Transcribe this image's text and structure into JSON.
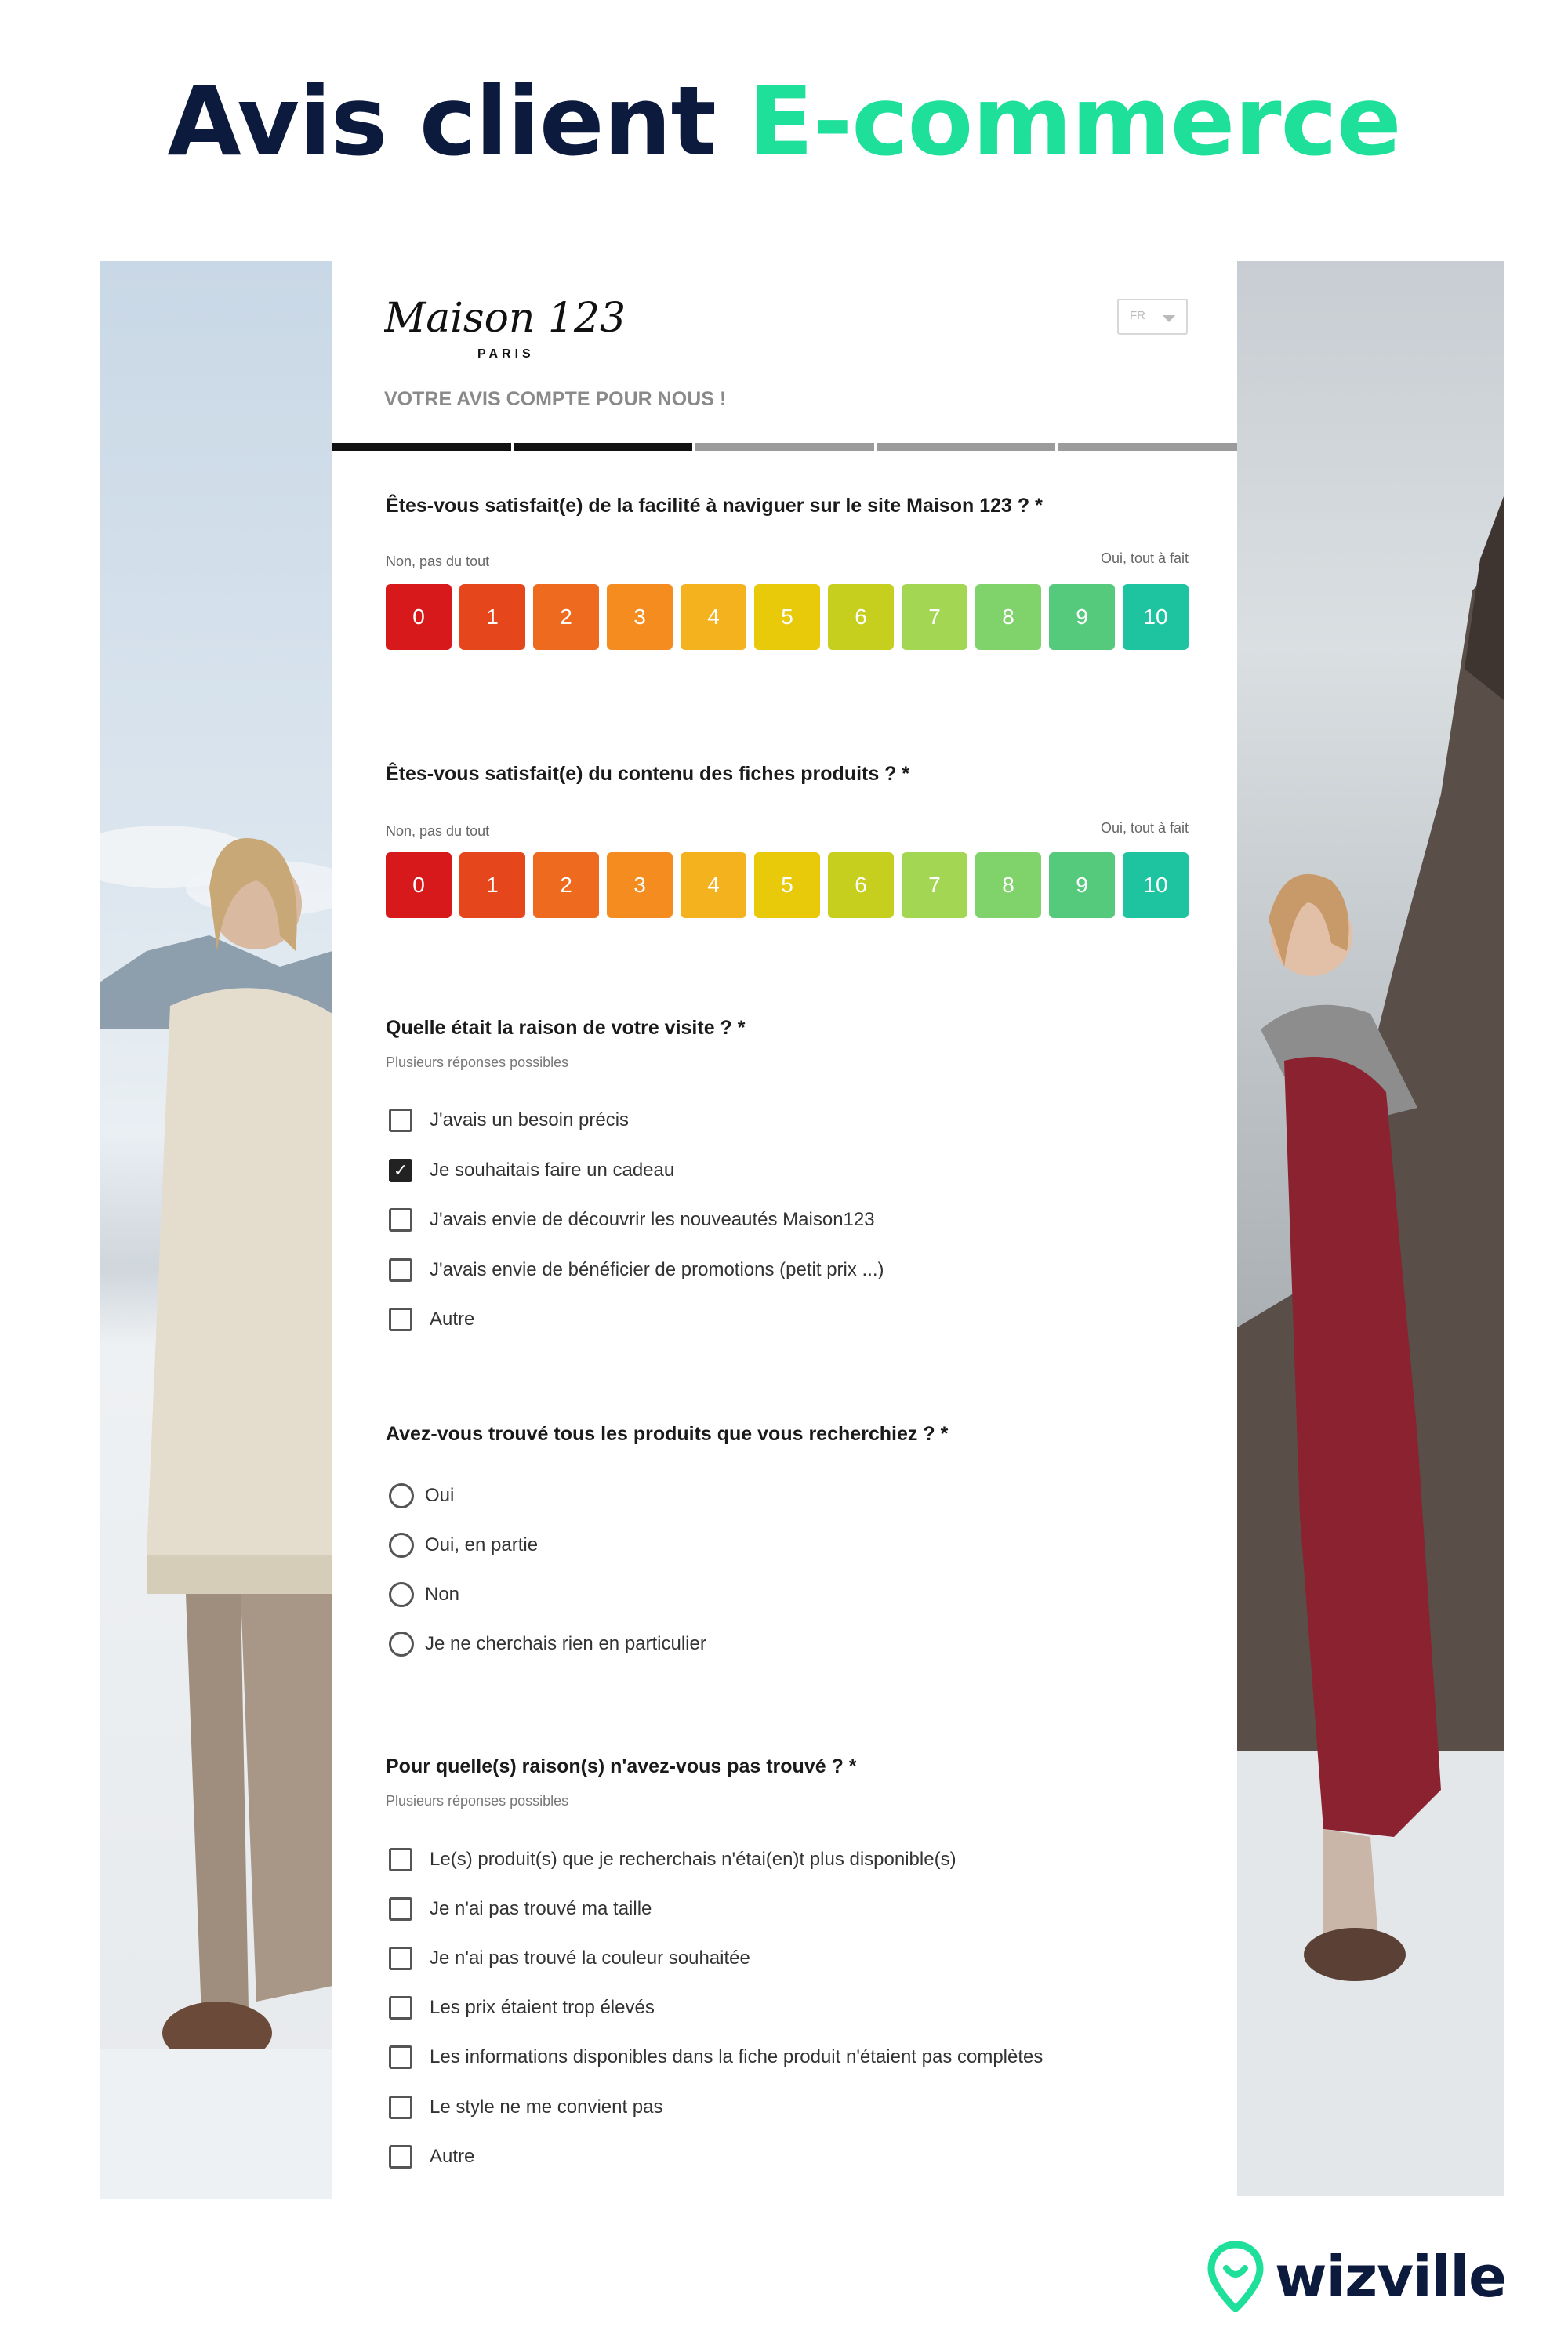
{
  "headline": {
    "part1": "Avis client",
    "part2": "E-commerce",
    "color1": "#0b1a3d",
    "color2": "#1ee09a"
  },
  "survey": {
    "logo_script": "Maison 123",
    "logo_sub": "PARIS",
    "language": "FR",
    "tagline": "VOTRE AVIS COMPTE POUR NOUS !",
    "progress": {
      "completed_steps": 2,
      "total_steps": 5
    },
    "q1": {
      "title": "Êtes-vous satisfait(e) de la facilité à naviguer sur le site Maison 123 ? *",
      "low_label": "Non, pas du tout",
      "high_label": "Oui, tout à fait",
      "scale": [
        "0",
        "1",
        "2",
        "3",
        "4",
        "5",
        "6",
        "7",
        "8",
        "9",
        "10"
      ]
    },
    "q2": {
      "title": "Êtes-vous satisfait(e) du contenu des fiches produits ? *",
      "low_label": "Non, pas du tout",
      "high_label": "Oui, tout à fait",
      "scale": [
        "0",
        "1",
        "2",
        "3",
        "4",
        "5",
        "6",
        "7",
        "8",
        "9",
        "10"
      ]
    },
    "scale_colors": [
      "#d7191c",
      "#e6461c",
      "#ed6a1f",
      "#f58c1f",
      "#f5b21f",
      "#e8ca0b",
      "#c6cf1d",
      "#a3d653",
      "#7fd36a",
      "#55c97c",
      "#1ec3a0"
    ],
    "q3": {
      "title": "Quelle était la raison de votre visite ? *",
      "subtitle": "Plusieurs réponses possibles",
      "options": [
        {
          "label": "J'avais un besoin précis",
          "checked": false
        },
        {
          "label": "Je souhaitais faire un cadeau",
          "checked": true
        },
        {
          "label": "J'avais envie de découvrir les nouveautés Maison123",
          "checked": false
        },
        {
          "label": "J'avais envie de bénéficier de promotions (petit prix ...)",
          "checked": false
        },
        {
          "label": "Autre",
          "checked": false
        }
      ]
    },
    "q4": {
      "title": "Avez-vous trouvé tous les produits que vous recherchiez ? *",
      "options": [
        {
          "label": "Oui"
        },
        {
          "label": "Oui, en partie"
        },
        {
          "label": "Non"
        },
        {
          "label": "Je ne cherchais rien en particulier"
        }
      ]
    },
    "q5": {
      "title": "Pour quelle(s) raison(s) n'avez-vous pas trouvé ? *",
      "subtitle": "Plusieurs réponses possibles",
      "options": [
        {
          "label": "Le(s) produit(s) que je recherchais n'étai(en)t plus disponible(s)"
        },
        {
          "label": "Je n'ai pas trouvé ma taille"
        },
        {
          "label": "Je n'ai pas trouvé la couleur souhaitée"
        },
        {
          "label": "Les prix étaient trop élevés"
        },
        {
          "label": "Les informations disponibles dans la fiche produit n'étaient pas complètes"
        },
        {
          "label": "Le style ne me convient pas"
        },
        {
          "label": "Autre"
        }
      ]
    }
  },
  "brand": {
    "name": "wizville",
    "pin_color": "#1ee09a"
  }
}
